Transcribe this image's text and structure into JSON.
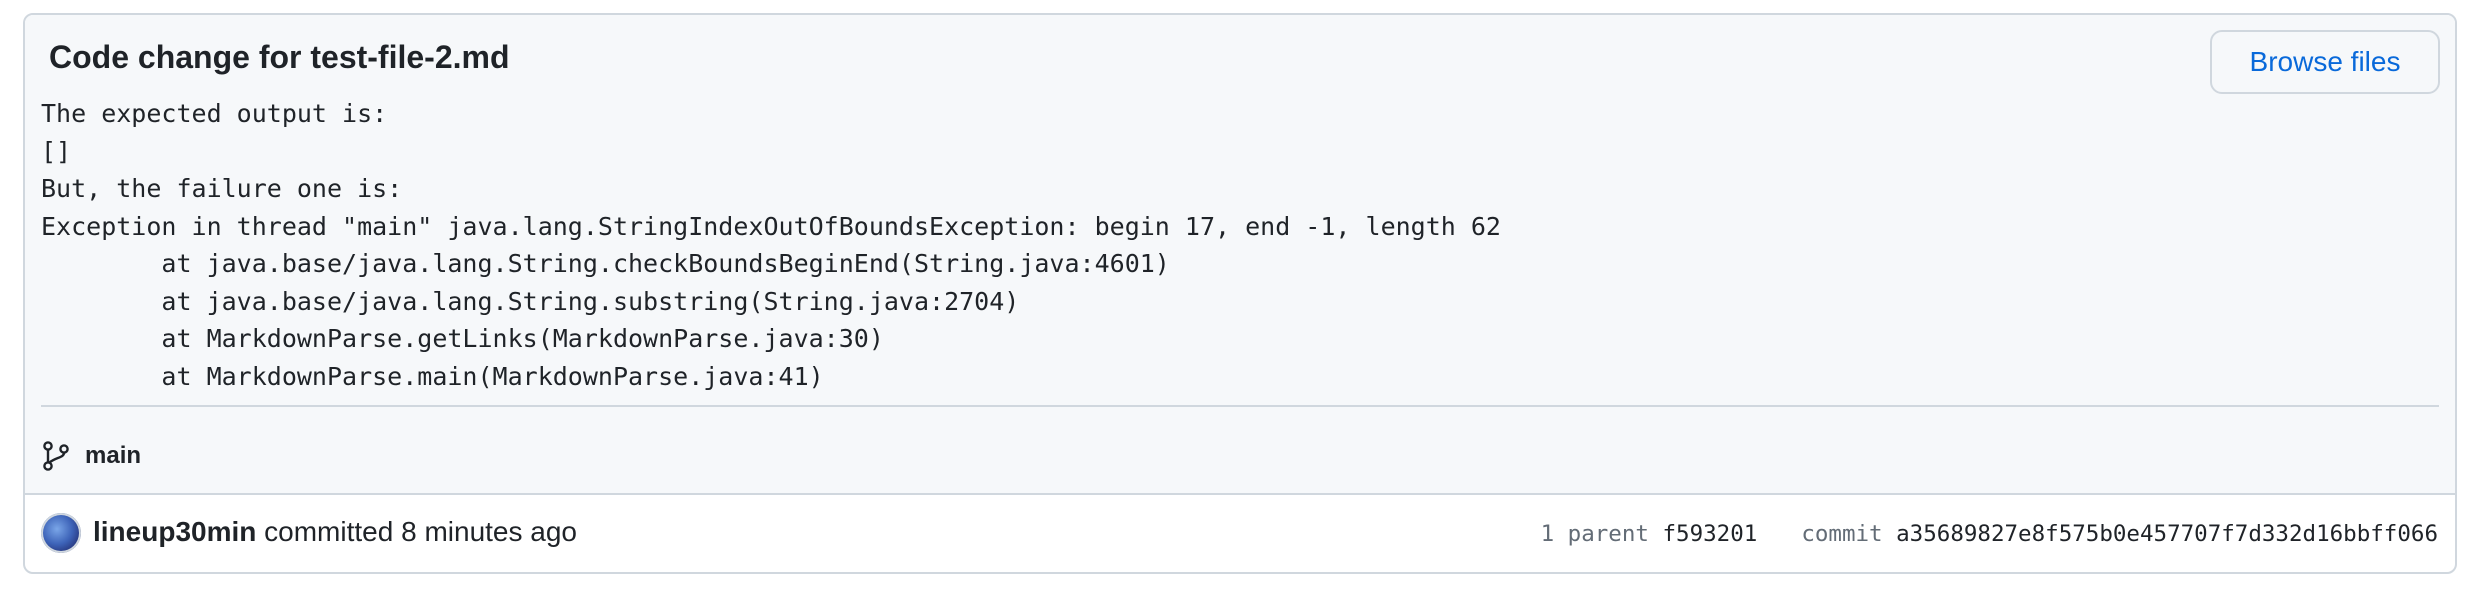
{
  "commit": {
    "title": "Code change for test-file-2.md",
    "browse_files_label": "Browse files",
    "description": "The expected output is:\n[]\nBut, the failure one is:\nException in thread \"main\" java.lang.StringIndexOutOfBoundsException: begin 17, end -1, length 62\n        at java.base/java.lang.String.checkBoundsBeginEnd(String.java:4601)\n        at java.base/java.lang.String.substring(String.java:2704)\n        at MarkdownParse.getLinks(MarkdownParse.java:30)\n        at MarkdownParse.main(MarkdownParse.java:41)",
    "branch": "main",
    "author": "lineup30min",
    "committed_text": "committed",
    "time_ago": "8 minutes ago",
    "parent_label": "1 parent",
    "parent_sha": "f593201",
    "commit_label": "commit",
    "commit_sha": "a35689827e8f575b0e457707f7d332d16bbff066"
  },
  "icons": {
    "branch": "git-branch-icon",
    "avatar": "user-avatar"
  },
  "colors": {
    "link": "#0969da",
    "border": "#d0d7de",
    "header_bg": "#f6f8fa",
    "muted": "#636c76",
    "text": "#1f2328"
  }
}
